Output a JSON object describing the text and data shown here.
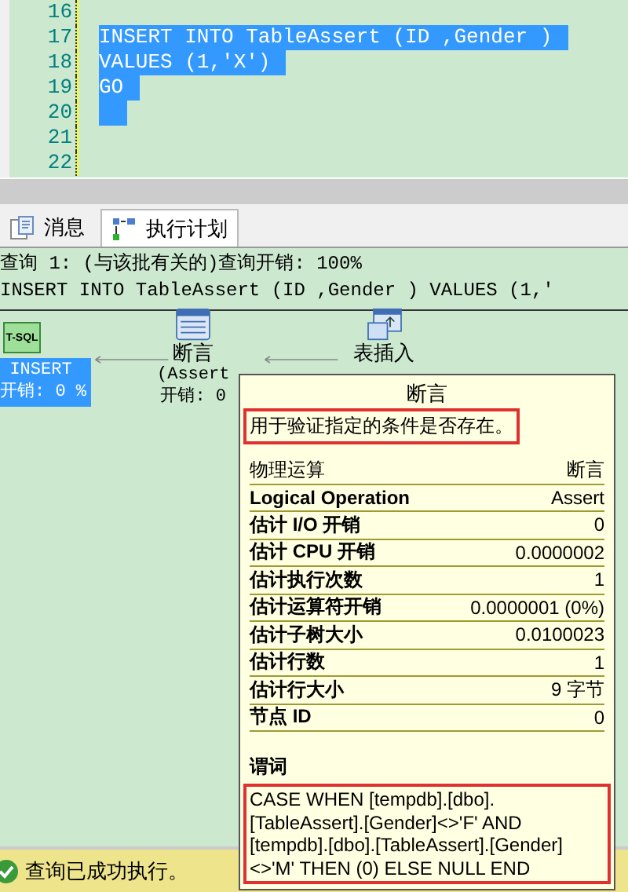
{
  "editor": {
    "lines": [
      {
        "number": "16",
        "selected": false
      },
      {
        "number": "17",
        "code": "INSERT INTO TableAssert (ID ,Gender )",
        "selected": true
      },
      {
        "number": "18",
        "code": "VALUES (1,'X')",
        "selected": true
      },
      {
        "number": "19",
        "code": "GO",
        "selected": true
      },
      {
        "number": "20",
        "selected": true
      },
      {
        "number": "21",
        "selected": false
      },
      {
        "number": "22",
        "selected": false
      }
    ]
  },
  "tabs": [
    {
      "label": "消息",
      "selected": false
    },
    {
      "label": "执行计划",
      "selected": true
    }
  ],
  "plan_header": {
    "query_line": "查询 1: (与该批有关的)查询开销: 100%",
    "statement": "INSERT INTO TableAssert (ID ,Gender ) VALUES (1,'"
  },
  "plan_nodes": [
    {
      "kind": "tsql",
      "icon_text": "T-SQL",
      "label": "INSERT",
      "cost": "开销: 0 %",
      "selected": true
    },
    {
      "kind": "assert",
      "label": "断言",
      "sublabel": "(Assert",
      "cost": "开销: 0",
      "selected": false
    },
    {
      "kind": "table_insert",
      "label": "表插入",
      "selected": false
    }
  ],
  "tooltip": {
    "title": "断言",
    "description": "用于验证指定的条件是否存在。",
    "properties": [
      {
        "name": "物理运算",
        "value": "断言",
        "bold": false
      },
      {
        "name": "Logical Operation",
        "value": "Assert",
        "bold": true
      },
      {
        "name": "估计 I/O 开销",
        "value": "0",
        "bold": true
      },
      {
        "name": "估计 CPU 开销",
        "value": "0.0000002",
        "bold": true
      },
      {
        "name": "估计执行次数",
        "value": "1",
        "bold": true
      },
      {
        "name": "估计运算符开销",
        "value": "0.0000001 (0%)",
        "bold": true
      },
      {
        "name": "估计子树大小",
        "value": "0.0100023",
        "bold": true
      },
      {
        "name": "估计行数",
        "value": "1",
        "bold": true
      },
      {
        "name": "估计行大小",
        "value": "9 字节",
        "bold": true
      },
      {
        "name": "节点 ID",
        "value": "0",
        "bold": true
      }
    ],
    "predicate_title": "谓词",
    "predicate": "CASE WHEN [tempdb].[dbo].[TableAssert].[Gender]<>'F' AND [tempdb].[dbo].[TableAssert].[Gender]<>'M' THEN (0) ELSE NULL END"
  },
  "status_bar": {
    "text": "查询已成功执行。"
  }
}
